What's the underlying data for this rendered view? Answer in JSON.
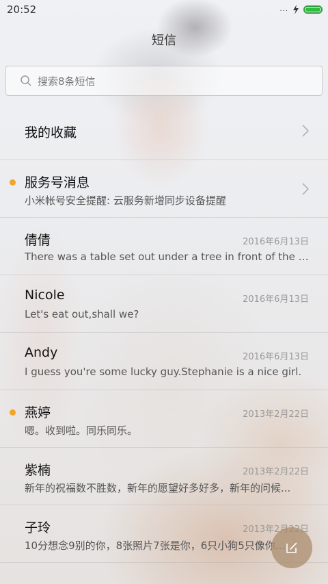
{
  "status_bar": {
    "time": "20:52",
    "signal_dots": "...",
    "battery_level": 1.0,
    "battery_color": "#2ebd3f"
  },
  "header": {
    "title": "短信"
  },
  "search": {
    "placeholder": "搜索8条短信"
  },
  "accent_color": "#f4a428",
  "conversations": [
    {
      "name": "我的收藏",
      "preview": "",
      "date": "",
      "unread": false,
      "chevron": true
    },
    {
      "name": "服务号消息",
      "preview": "小米帐号安全提醒: 云服务新增同步设备提醒",
      "date": "",
      "unread": true,
      "chevron": true
    },
    {
      "name": "倩倩",
      "preview": "There was a table set out under a tree in front of the ho...",
      "date": "2016年6月13日",
      "unread": false,
      "chevron": false
    },
    {
      "name": "Nicole",
      "preview": "Let's eat out,shall we?",
      "date": "2016年6月13日",
      "unread": false,
      "chevron": false
    },
    {
      "name": "Andy",
      "preview": "I guess you're some lucky guy.Stephanie is a nice girl.",
      "date": "2016年6月13日",
      "unread": false,
      "chevron": false
    },
    {
      "name": "燕婷",
      "preview": "嗯。收到啦。同乐同乐。",
      "date": "2013年2月22日",
      "unread": true,
      "chevron": false
    },
    {
      "name": "紫楠",
      "preview": "新年的祝福数不胜数，新年的愿望好多好多，新年的问候...",
      "date": "2013年2月22日",
      "unread": false,
      "chevron": false
    },
    {
      "name": "子玲",
      "preview": "10分想念9别的你，8张照片7张是你，6只小狗5只像你...",
      "date": "2013年2月22日",
      "unread": false,
      "chevron": false
    }
  ],
  "compose_icon": "compose-icon"
}
